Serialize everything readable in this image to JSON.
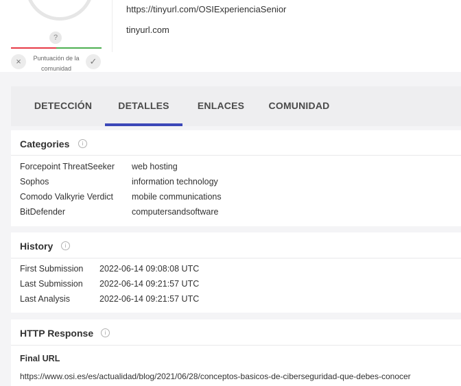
{
  "header": {
    "url": "https://tinyurl.com/OSIExperienciaSenior",
    "domain": "tinyurl.com",
    "score_unknown": "?",
    "community_label": "Puntuación de la comunidad",
    "vote_down_icon": "×",
    "vote_up_icon": "✓"
  },
  "tabs": [
    {
      "label": "DETECCIÓN",
      "active": false
    },
    {
      "label": "DETALLES",
      "active": true
    },
    {
      "label": "ENLACES",
      "active": false
    },
    {
      "label": "COMUNIDAD",
      "active": false
    }
  ],
  "categories": {
    "title": "Categories",
    "rows": [
      {
        "key": "Forcepoint ThreatSeeker",
        "value": "web hosting"
      },
      {
        "key": "Sophos",
        "value": "information technology"
      },
      {
        "key": "Comodo Valkyrie Verdict",
        "value": "mobile communications"
      },
      {
        "key": "BitDefender",
        "value": "computersandsoftware"
      }
    ]
  },
  "history": {
    "title": "History",
    "rows": [
      {
        "key": "First Submission",
        "value": "2022-06-14 09:08:08 UTC"
      },
      {
        "key": "Last Submission",
        "value": "2022-06-14 09:21:57 UTC"
      },
      {
        "key": "Last Analysis",
        "value": "2022-06-14 09:21:57 UTC"
      }
    ]
  },
  "http_response": {
    "title": "HTTP Response",
    "final_url_label": "Final URL",
    "final_url": "https://www.osi.es/es/actualidad/blog/2021/06/28/conceptos-basicos-de-ciberseguridad-que-debes-conocer"
  },
  "colors": {
    "accent": "#3b47b8",
    "malicious": "#e63946",
    "harmless": "#4caf50"
  }
}
